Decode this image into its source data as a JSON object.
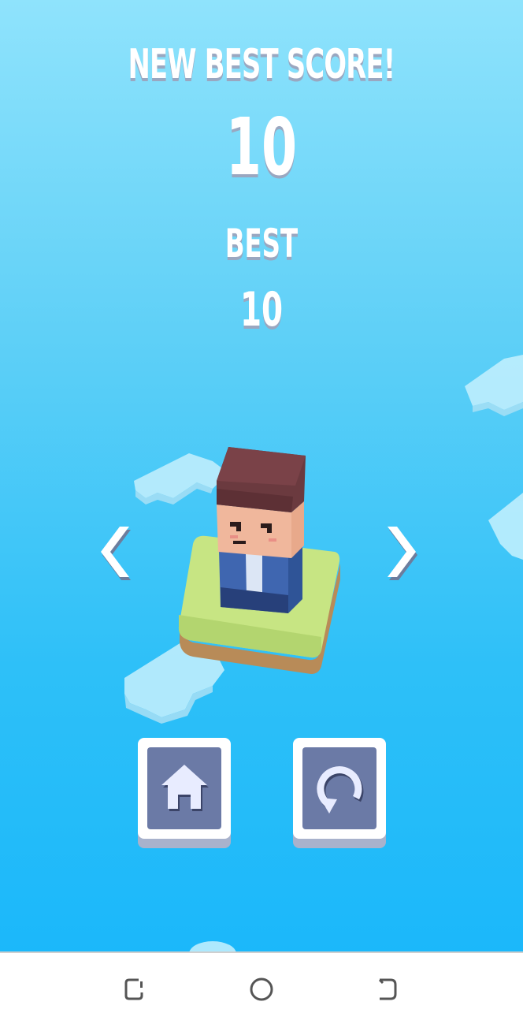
{
  "header": {
    "new_best_label": "NEW BEST SCORE!",
    "score": "10",
    "best_label": "BEST",
    "best_value": "10"
  },
  "character": {
    "name": "blocky-boy",
    "colors": {
      "hair": "#6b3a3f",
      "skin": "#f0b79c",
      "shirt": "#3f66b0",
      "pants": "#27407a"
    }
  },
  "buttons": {
    "home_icon": "house-icon",
    "restart_icon": "restart-icon",
    "prev_icon": "chevron-left-icon",
    "next_icon": "chevron-right-icon"
  },
  "navbar": {
    "recent_icon": "recent-apps-icon",
    "home_icon": "circle-home-icon",
    "back_icon": "back-icon"
  },
  "colors": {
    "sky_top": "#8fe3fc",
    "sky_bottom": "#1bb8fa",
    "button_face": "#6b7aa6",
    "grass": "#c7e583",
    "dirt": "#b88b58"
  }
}
